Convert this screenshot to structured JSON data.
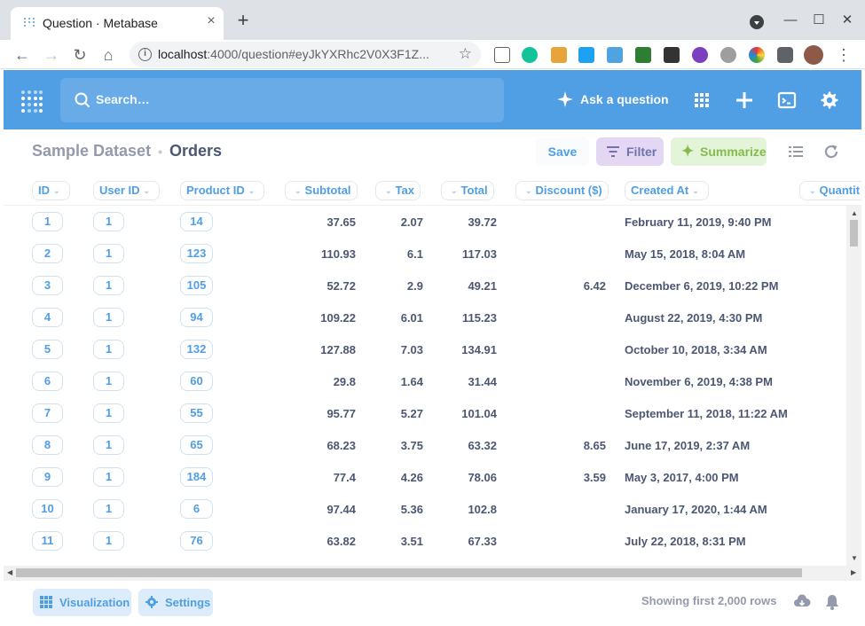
{
  "browser": {
    "tab_title": "Question · Metabase",
    "tab_close": "×",
    "new_tab": "+",
    "url_host": "localhost",
    "url_rest": ":4000/question#eyJkYXRhc2V0X3F1Z...",
    "controls": {
      "minimize": "—",
      "maximize": "☐",
      "close": "✕"
    }
  },
  "nav": {
    "search_placeholder": "Search…",
    "ask_label": "Ask a question"
  },
  "header": {
    "database": "Sample Dataset",
    "table": "Orders",
    "save_label": "Save",
    "filter_label": "Filter",
    "summarize_label": "Summarize"
  },
  "columns": [
    {
      "label": "ID"
    },
    {
      "label": "User ID"
    },
    {
      "label": "Product ID"
    },
    {
      "label": "Subtotal"
    },
    {
      "label": "Tax"
    },
    {
      "label": "Total"
    },
    {
      "label": "Discount ($)"
    },
    {
      "label": "Created At"
    },
    {
      "label": "Quantit"
    }
  ],
  "rows": [
    {
      "id": "1",
      "user_id": "1",
      "product_id": "14",
      "subtotal": "37.65",
      "tax": "2.07",
      "total": "39.72",
      "discount": "",
      "created_at": "February 11, 2019, 9:40 PM"
    },
    {
      "id": "2",
      "user_id": "1",
      "product_id": "123",
      "subtotal": "110.93",
      "tax": "6.1",
      "total": "117.03",
      "discount": "",
      "created_at": "May 15, 2018, 8:04 AM"
    },
    {
      "id": "3",
      "user_id": "1",
      "product_id": "105",
      "subtotal": "52.72",
      "tax": "2.9",
      "total": "49.21",
      "discount": "6.42",
      "created_at": "December 6, 2019, 10:22 PM"
    },
    {
      "id": "4",
      "user_id": "1",
      "product_id": "94",
      "subtotal": "109.22",
      "tax": "6.01",
      "total": "115.23",
      "discount": "",
      "created_at": "August 22, 2019, 4:30 PM"
    },
    {
      "id": "5",
      "user_id": "1",
      "product_id": "132",
      "subtotal": "127.88",
      "tax": "7.03",
      "total": "134.91",
      "discount": "",
      "created_at": "October 10, 2018, 3:34 AM"
    },
    {
      "id": "6",
      "user_id": "1",
      "product_id": "60",
      "subtotal": "29.8",
      "tax": "1.64",
      "total": "31.44",
      "discount": "",
      "created_at": "November 6, 2019, 4:38 PM"
    },
    {
      "id": "7",
      "user_id": "1",
      "product_id": "55",
      "subtotal": "95.77",
      "tax": "5.27",
      "total": "101.04",
      "discount": "",
      "created_at": "September 11, 2018, 11:22 AM"
    },
    {
      "id": "8",
      "user_id": "1",
      "product_id": "65",
      "subtotal": "68.23",
      "tax": "3.75",
      "total": "63.32",
      "discount": "8.65",
      "created_at": "June 17, 2019, 2:37 AM"
    },
    {
      "id": "9",
      "user_id": "1",
      "product_id": "184",
      "subtotal": "77.4",
      "tax": "4.26",
      "total": "78.06",
      "discount": "3.59",
      "created_at": "May 3, 2017, 4:00 PM"
    },
    {
      "id": "10",
      "user_id": "1",
      "product_id": "6",
      "subtotal": "97.44",
      "tax": "5.36",
      "total": "102.8",
      "discount": "",
      "created_at": "January 17, 2020, 1:44 AM"
    },
    {
      "id": "11",
      "user_id": "1",
      "product_id": "76",
      "subtotal": "63.82",
      "tax": "3.51",
      "total": "67.33",
      "discount": "",
      "created_at": "July 22, 2018, 8:31 PM"
    }
  ],
  "footer": {
    "visualization_label": "Visualization",
    "settings_label": "Settings",
    "row_count": "Showing first 2,000 rows"
  },
  "colors": {
    "brand": "#509ee3",
    "filter_bg": "#e3d7f3",
    "summarize_bg": "#e3f4d8",
    "text": "#4c5773"
  },
  "icons": [
    "metabase-logo-icon",
    "search-icon",
    "sparkle-icon",
    "grid-icon",
    "plus-icon",
    "sql-editor-icon",
    "gear-icon",
    "list-icon",
    "refresh-icon",
    "download-icon",
    "bell-icon"
  ]
}
